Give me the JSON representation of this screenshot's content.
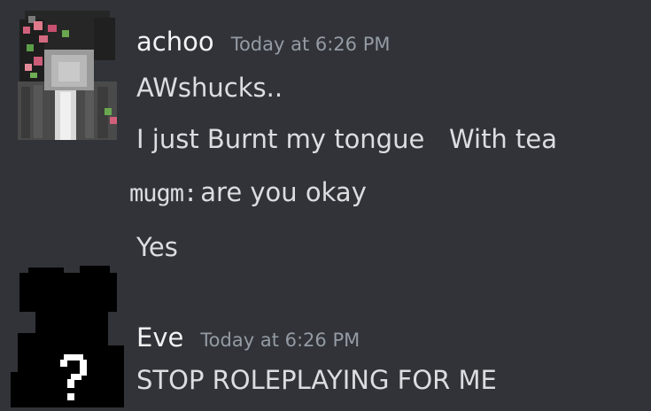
{
  "messages": [
    {
      "author": "achoo",
      "timestamp": "Today at 6:26 PM",
      "avatar_icon": "minecraft-skin-avatar-icon",
      "lines": [
        "AWshucks..",
        "I just Burnt my tongue   With tea"
      ],
      "inline_line": {
        "prefix": "mugm:",
        "text": "are you okay"
      },
      "last_line": "Yes"
    },
    {
      "author": "Eve",
      "timestamp": "Today at 6:26 PM",
      "avatar_icon": "silhouette-question-avatar-icon",
      "lines": [
        "STOP ROLEPLAYING FOR ME"
      ]
    }
  ],
  "colors": {
    "background": "#313338",
    "username": "#f2f3f5",
    "timestamp": "#949ba4",
    "message_text": "#dbdee1"
  }
}
